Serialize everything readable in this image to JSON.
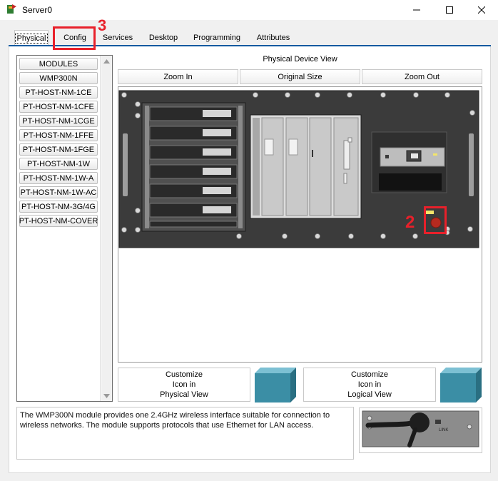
{
  "window": {
    "title": "Server0"
  },
  "tabs": [
    {
      "label": "Physical",
      "active": true
    },
    {
      "label": "Config",
      "active": false
    },
    {
      "label": "Services",
      "active": false
    },
    {
      "label": "Desktop",
      "active": false
    },
    {
      "label": "Programming",
      "active": false
    },
    {
      "label": "Attributes",
      "active": false
    }
  ],
  "modules": {
    "items": [
      "MODULES",
      "WMP300N",
      "PT-HOST-NM-1CE",
      "PT-HOST-NM-1CFE",
      "PT-HOST-NM-1CGE",
      "PT-HOST-NM-1FFE",
      "PT-HOST-NM-1FGE",
      "PT-HOST-NM-1W",
      "PT-HOST-NM-1W-A",
      "PT-HOST-NM-1W-AC",
      "PT-HOST-NM-3G/4G",
      "PT-HOST-NM-COVER"
    ]
  },
  "physical_view": {
    "title": "Physical Device View",
    "zoom_in": "Zoom In",
    "original_size": "Original Size",
    "zoom_out": "Zoom Out"
  },
  "annotations": {
    "power_marker": "2",
    "config_marker": "3"
  },
  "customize": {
    "physical": [
      "Customize",
      "Icon in",
      "Physical View"
    ],
    "logical": [
      "Customize",
      "Icon in",
      "Logical View"
    ]
  },
  "description": {
    "text": "The WMP300N module provides one 2.4GHz wireless interface suitable for connection to wireless networks. The module supports protocols that use Ethernet for LAN access."
  },
  "module_image": {
    "port_label": "LINK"
  },
  "colors": {
    "annotation_red": "#e8202a",
    "tab_underline": "#0a5aa0",
    "cube_teal": "#3b8ea5"
  }
}
